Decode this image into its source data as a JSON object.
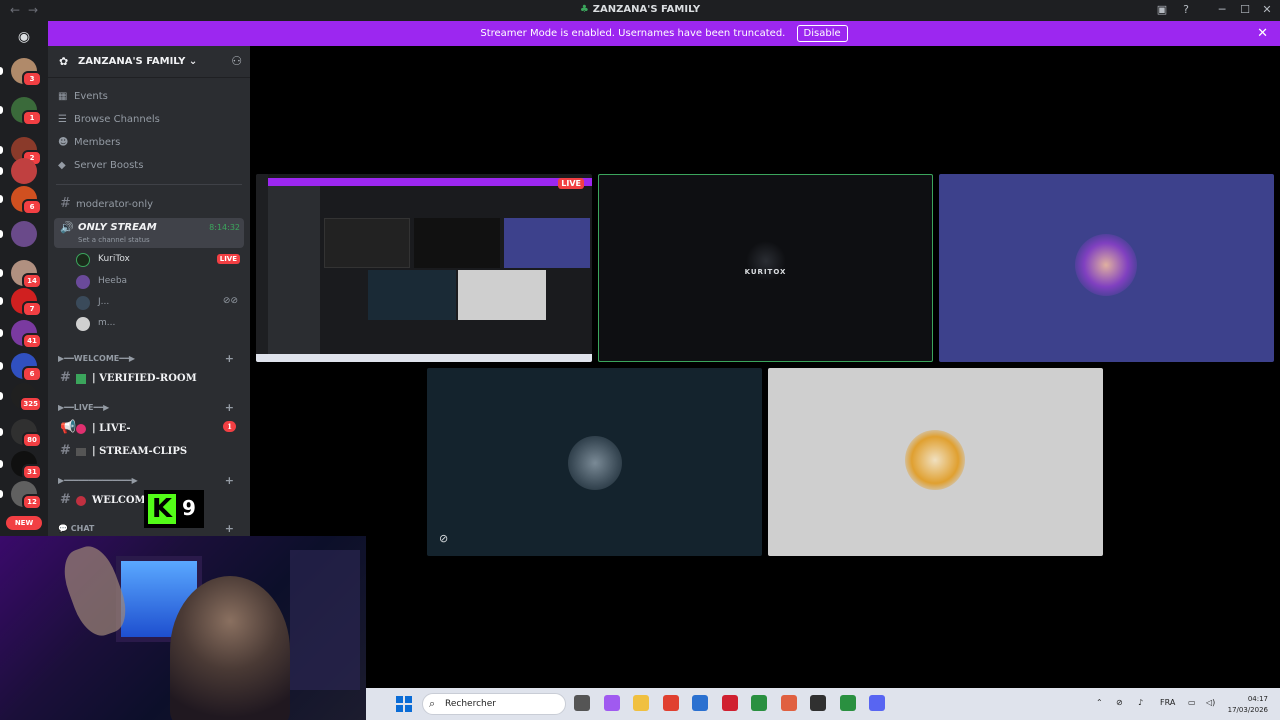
{
  "window": {
    "title": "ZANZANA'S FAMILY",
    "back_glyph": "←",
    "forward_glyph": "→"
  },
  "banner": {
    "message": "Streamer Mode is enabled. Usernames have been truncated.",
    "disable_label": "Disable",
    "close_glyph": "✕"
  },
  "rail": {
    "servers": [
      {
        "badge": "3",
        "color": "#b08a6a"
      },
      {
        "badge": "1",
        "color": "#3a6a3a"
      },
      {
        "badge": "2",
        "color": "#8a3a2a"
      },
      {
        "badge": "",
        "color": "#c04040"
      },
      {
        "badge": "6",
        "color": "#d05020"
      },
      {
        "badge": "",
        "color": "#6a4a8a"
      },
      {
        "badge": "14",
        "color": "#b09080"
      },
      {
        "badge": "7",
        "color": "#d02020"
      },
      {
        "badge": "41",
        "color": "#7a3aa0"
      },
      {
        "badge": "6",
        "color": "#3050c0"
      },
      {
        "badge": "325",
        "color": "#202020"
      },
      {
        "badge": "80",
        "color": "#303030"
      },
      {
        "badge": "31",
        "color": "#101010"
      },
      {
        "badge": "12",
        "color": "#606060"
      }
    ],
    "new_label": "NEW"
  },
  "sidebar": {
    "server_name": "ZANZANA'S FAMILY",
    "menu": [
      {
        "icon": "calendar-icon",
        "label": "Events"
      },
      {
        "icon": "browse-channels-icon",
        "label": "Browse Channels"
      },
      {
        "icon": "members-icon",
        "label": "Members"
      },
      {
        "icon": "server-boost-icon",
        "label": "Server Boosts"
      }
    ],
    "moderator_channel": "moderator-only",
    "active_channel": {
      "name": "ONLY STREAM",
      "time": "8:14:32",
      "status": "Set a channel status"
    },
    "voice_users": [
      {
        "name": "KuriTox",
        "live": "LIVE",
        "color": "#1a2a1a"
      },
      {
        "name": "Heeba",
        "live": "",
        "color": "#6a4a9a"
      },
      {
        "name": "J...",
        "live": "",
        "color": "#3a4a5a"
      },
      {
        "name": "m...",
        "live": "",
        "color": "#d0d0d0"
      }
    ],
    "categories": [
      {
        "label": "▶━━WELCOME━━▶"
      },
      {
        "label": "▶━━LIVE━━▶"
      },
      {
        "label": "▶━━━━━━━━━━━━━━▶"
      },
      {
        "label": "💬 CHAT"
      }
    ],
    "channels": {
      "verified": "| VERIFIED-ROOM",
      "live": "| LIVE-",
      "live_badge": "1",
      "stream_clips": "| STREAM-CLIPS",
      "welcome": "WELCOM"
    }
  },
  "kick": {
    "logo": "K",
    "number": "9"
  },
  "stage": {
    "live_label": "LIVE",
    "kuritox_logo": "KURITOX"
  },
  "taskbar": {
    "search_placeholder": "Rechercher",
    "lang": "FRA",
    "time": "04:17",
    "date": "17/03/2026"
  }
}
